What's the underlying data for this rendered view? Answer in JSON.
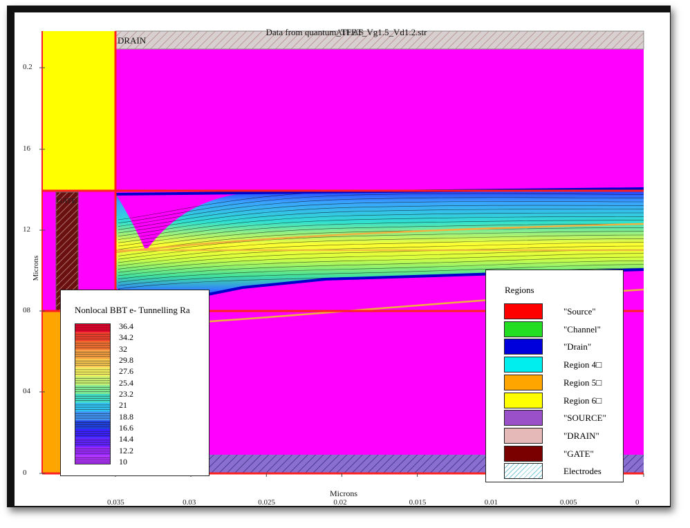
{
  "chart_data": {
    "type": "heatmap",
    "title": "Data from quantum_TFET_Vg1.5_Vd1.2.str",
    "overlay_title": "ATLAS",
    "xlabel": "Microns",
    "ylabel": "Microns",
    "x_ticks": [
      "0.035",
      "0.03",
      "0.025",
      "0.02",
      "0.015",
      "0.01",
      "0.005",
      "0"
    ],
    "y_ticks": [
      "0.2",
      "16",
      "12",
      "08",
      "04",
      "0"
    ],
    "electrode_labels": {
      "drain": "DRAIN",
      "gate": "GATE"
    },
    "colorbar": {
      "title": "Nonlocal BBT e- Tunnelling Ra",
      "labels": [
        "36.4",
        "34.2",
        "32",
        "29.8",
        "27.6",
        "25.4",
        "23.2",
        "21",
        "18.8",
        "16.6",
        "14.4",
        "12.2",
        "10"
      ],
      "range": [
        10,
        36.4
      ]
    },
    "regions_legend": {
      "title": "Regions",
      "items": [
        {
          "label": "\"Source\"",
          "color": "#ff0000"
        },
        {
          "label": "\"Channel\"",
          "color": "#22dd22"
        },
        {
          "label": "\"Drain\"",
          "color": "#0000dd"
        },
        {
          "label": "Region 4□",
          "color": "#00eeee"
        },
        {
          "label": "Region 5□",
          "color": "#ffa500"
        },
        {
          "label": "Region 6□",
          "color": "#ffff00"
        },
        {
          "label": "\"SOURCE\"",
          "color": "#9a50c8"
        },
        {
          "label": "\"DRAIN\"",
          "color": "#e6b9b9"
        },
        {
          "label": "\"GATE\"",
          "color": "#7a0000"
        },
        {
          "label": "Electrodes",
          "color": "hatch"
        }
      ]
    }
  }
}
